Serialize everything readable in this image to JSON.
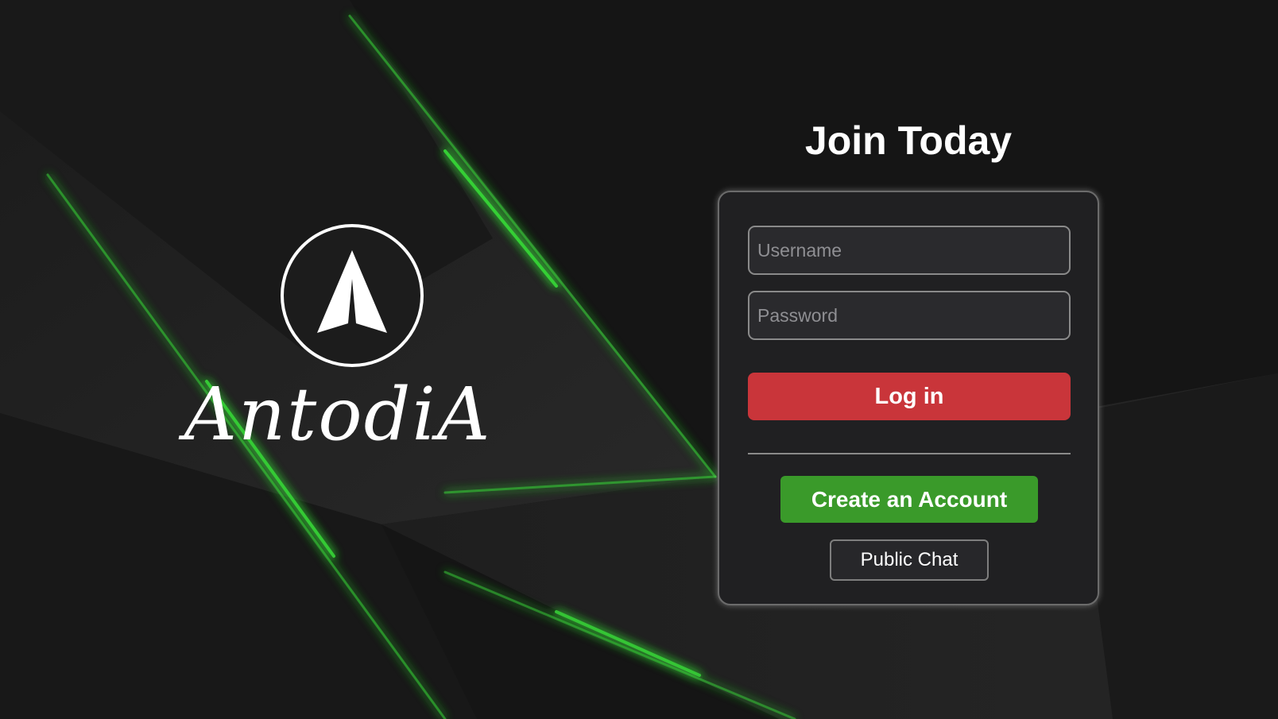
{
  "brand": {
    "name": "AntodiA",
    "logo_icon": "arrow-up-compass-icon"
  },
  "auth": {
    "title": "Join Today",
    "username_placeholder": "Username",
    "password_placeholder": "Password",
    "login_label": "Log in",
    "create_label": "Create an Account",
    "public_chat_label": "Public Chat"
  },
  "colors": {
    "background": "#161616",
    "accent_green_glow": "#37d437",
    "login_button": "#c9353a",
    "create_button": "#3a9a2a",
    "card": "#202022"
  }
}
